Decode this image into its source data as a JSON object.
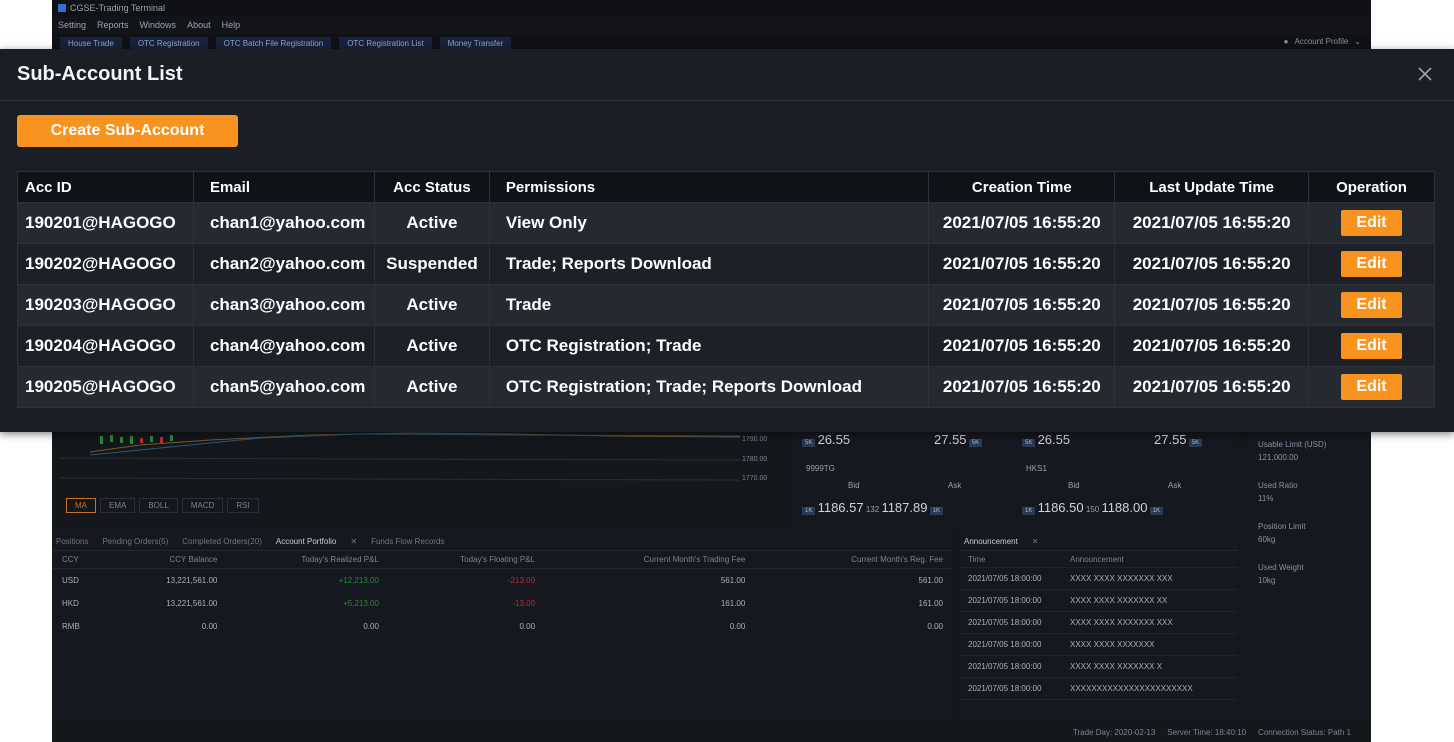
{
  "app": {
    "title": "CGSE-Trading Terminal",
    "menu": [
      "Setting",
      "Reports",
      "Windows",
      "About",
      "Help"
    ],
    "nav_tabs": [
      "House Trade",
      "OTC Registration",
      "OTC Batch File Registration",
      "OTC Registration List",
      "Money Transfer"
    ],
    "account_profile": "Account Profile"
  },
  "background": {
    "price_labels": [
      "1790.00",
      "1780.00",
      "1770.00"
    ],
    "indicators": [
      "MA",
      "EMA",
      "BOLL",
      "MACD",
      "RSI"
    ],
    "quotes": [
      {
        "name": "",
        "bid_lot": "5K",
        "bid": "26.55",
        "ask": "27.55",
        "ask_lot": "5K"
      },
      {
        "name": "",
        "bid_lot": "5K",
        "bid": "26.55",
        "ask": "27.55",
        "ask_lot": "5K"
      },
      {
        "name": "9999TG",
        "bid_label": "Bid",
        "ask_label": "Ask",
        "bid_lot": "1K",
        "bid": "1186.57",
        "mid": "132",
        "ask": "1187.89",
        "ask_lot": "1K"
      },
      {
        "name": "HKS1",
        "bid_label": "Bid",
        "ask_label": "Ask",
        "bid_lot": "1K",
        "bid": "1186.50",
        "mid": "150",
        "ask": "1188.00",
        "ask_lot": "1K"
      }
    ],
    "right_panel": [
      {
        "label": "Usable Limit (USD)",
        "value": "121,000.00"
      },
      {
        "label": "Used Ratio",
        "value": "11%"
      },
      {
        "label": "Position Limit",
        "value": "60kg"
      },
      {
        "label": "Used Weight",
        "value": "10kg"
      }
    ],
    "bottom_tabs": [
      "Positions",
      "Pending Orders(5)",
      "Completed Orders(20)",
      "Account Portfolio",
      "Funds Flow Records"
    ],
    "portfolio_headers": [
      "CCY",
      "CCY Balance",
      "Today's Realized P&L",
      "Today's Floating P&L",
      "Current Month's Trading Fee",
      "Current Month's Reg. Fee"
    ],
    "portfolio_rows": [
      [
        "USD",
        "13,221,561.00",
        "+12,213.00",
        "-213.00",
        "561.00",
        "561.00"
      ],
      [
        "HKD",
        "13,221,561.00",
        "+5,213.00",
        "-13.00",
        "161.00",
        "161.00"
      ],
      [
        "RMB",
        "0.00",
        "0.00",
        "0.00",
        "0.00",
        "0.00"
      ]
    ],
    "announcement_tab": "Announcement",
    "announcement_headers": [
      "Time",
      "Announcement"
    ],
    "announcements": [
      [
        "2021/07/05 18:00:00",
        "XXXX XXXX XXXXXXX XXX"
      ],
      [
        "2021/07/05 18:00:00",
        "XXXX XXXX XXXXXXX XX"
      ],
      [
        "2021/07/05 18:00:00",
        "XXXX XXXX XXXXXXX XXX"
      ],
      [
        "2021/07/05 18:00:00",
        "XXXX XXXX XXXXXXX"
      ],
      [
        "2021/07/05 18:00:00",
        "XXXX XXXX XXXXXXX X"
      ],
      [
        "2021/07/05 18:00:00",
        "XXXXXXXXXXXXXXXXXXXXXXX"
      ]
    ],
    "status": {
      "trade_day": "Trade Day: 2020-02-13",
      "server_time": "Server Time: 18:40:10",
      "connection": "Connection Status: Path 1"
    }
  },
  "modal": {
    "title": "Sub-Account List",
    "create_button": "Create Sub-Account",
    "headers": [
      "Acc ID",
      "Email",
      "Acc Status",
      "Permissions",
      "Creation Time",
      "Last Update Time",
      "Operation"
    ],
    "edit_label": "Edit",
    "rows": [
      {
        "acc_id": "190201@HAGOGO",
        "email": "chan1@yahoo.com",
        "status": "Active",
        "permissions": "View Only",
        "created": "2021/07/05 16:55:20",
        "updated": "2021/07/05 16:55:20"
      },
      {
        "acc_id": "190202@HAGOGO",
        "email": "chan2@yahoo.com",
        "status": "Suspended",
        "permissions": "Trade; Reports Download",
        "created": "2021/07/05 16:55:20",
        "updated": "2021/07/05 16:55:20"
      },
      {
        "acc_id": "190203@HAGOGO",
        "email": "chan3@yahoo.com",
        "status": "Active",
        "permissions": "Trade",
        "created": "2021/07/05 16:55:20",
        "updated": "2021/07/05 16:55:20"
      },
      {
        "acc_id": "190204@HAGOGO",
        "email": "chan4@yahoo.com",
        "status": "Active",
        "permissions": "OTC Registration; Trade",
        "created": "2021/07/05 16:55:20",
        "updated": "2021/07/05 16:55:20"
      },
      {
        "acc_id": "190205@HAGOGO",
        "email": "chan5@yahoo.com",
        "status": "Active",
        "permissions": "OTC Registration; Trade; Reports Download",
        "created": "2021/07/05 16:55:20",
        "updated": "2021/07/05 16:55:20"
      }
    ]
  },
  "colors": {
    "accent": "#f7931e",
    "modal_bg": "#1b1f25",
    "header_bg": "#0f1216"
  }
}
